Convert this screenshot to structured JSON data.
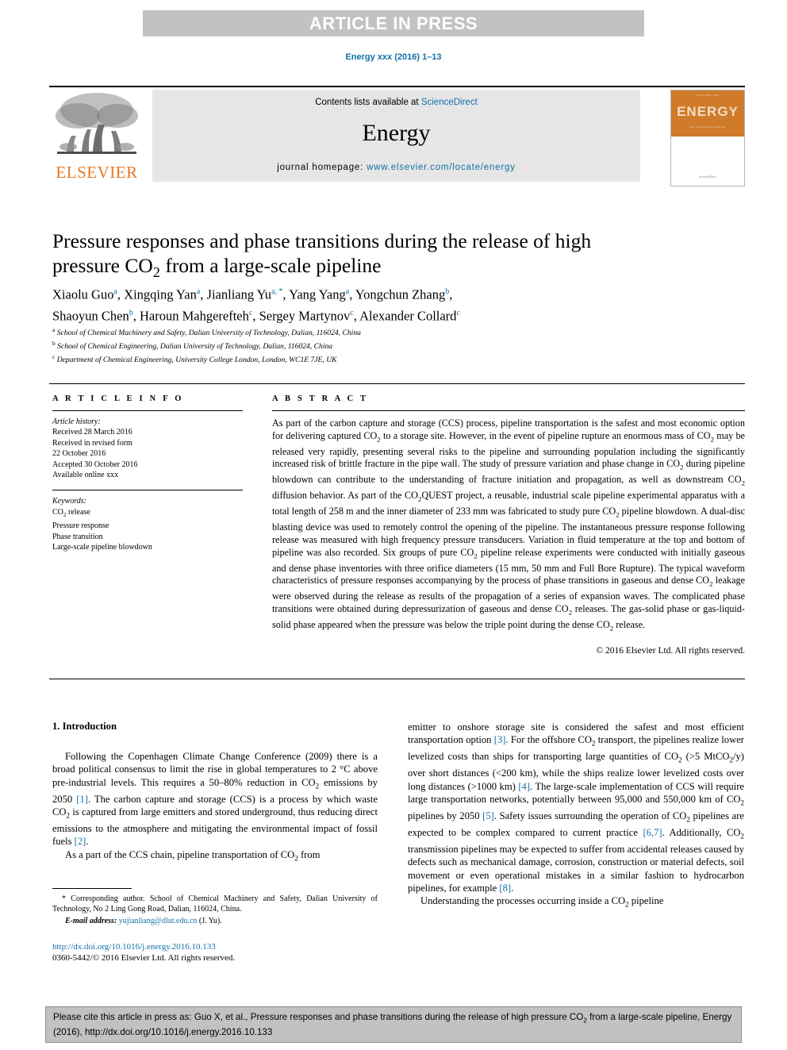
{
  "banner": {
    "label": "ARTICLE IN PRESS"
  },
  "journal_ref": "Energy xxx (2016) 1–13",
  "masthead": {
    "contents_prefix": "Contents lists available at ",
    "sciencedirect": "ScienceDirect",
    "journal_name": "Energy",
    "homepage_prefix": "journal homepage: ",
    "homepage_url": "www.elsevier.com/locate/energy",
    "publisher": "ELSEVIER",
    "cover_title": "ENERGY",
    "cover_subtitle": "The International Journal",
    "cover_footer": "ScienceDirect"
  },
  "article": {
    "title_line1": "Pressure responses and phase transitions during the release of high",
    "title_line2_a": "pressure CO",
    "title_line2_sub": "2",
    "title_line2_b": " from a large-scale pipeline",
    "authors": [
      {
        "name": "Xiaolu Guo",
        "marks": "a"
      },
      {
        "name": "Xingqing Yan",
        "marks": "a"
      },
      {
        "name": "Jianliang Yu",
        "marks": "a, *"
      },
      {
        "name": "Yang Yang",
        "marks": "a"
      },
      {
        "name": "Yongchun Zhang",
        "marks": "b"
      },
      {
        "name": "Shaoyun Chen",
        "marks": "b"
      },
      {
        "name": "Haroun Mahgerefteh",
        "marks": "c"
      },
      {
        "name": "Sergey Martynov",
        "marks": "c"
      },
      {
        "name": "Alexander Collard",
        "marks": "c"
      }
    ],
    "affiliations": [
      {
        "mark": "a",
        "text": "School of Chemical Machinery and Safety, Dalian University of Technology, Dalian, 116024, China"
      },
      {
        "mark": "b",
        "text": "School of Chemical Engineering, Dalian University of Technology, Dalian, 116024, China"
      },
      {
        "mark": "c",
        "text": "Department of Chemical Engineering, University College London, London, WC1E 7JE, UK"
      }
    ]
  },
  "article_info": {
    "heading": "A R T I C L E  I N F O",
    "history_label": "Article history:",
    "history": [
      "Received 28 March 2016",
      "Received in revised form",
      "22 October 2016",
      "Accepted 30 October 2016",
      "Available online xxx"
    ],
    "keywords_label": "Keywords:",
    "keywords": [
      "CO2 release",
      "Pressure response",
      "Phase transition",
      "Large-scale pipeline blowdown"
    ]
  },
  "abstract": {
    "heading": "A B S T R A C T",
    "text": "As part of the carbon capture and storage (CCS) process, pipeline transportation is the safest and most economic option for delivering captured CO2 to a storage site. However, in the event of pipeline rupture an enormous mass of CO2 may be released very rapidly, presenting several risks to the pipeline and surrounding population including the significantly increased risk of brittle fracture in the pipe wall. The study of pressure variation and phase change in CO2 during pipeline blowdown can contribute to the understanding of fracture initiation and propagation, as well as downstream CO2 diffusion behavior. As part of the CO2QUEST project, a reusable, industrial scale pipeline experimental apparatus with a total length of 258 m and the inner diameter of 233 mm was fabricated to study pure CO2 pipeline blowdown. A dual-disc blasting device was used to remotely control the opening of the pipeline. The instantaneous pressure response following release was measured with high frequency pressure transducers. Variation in fluid temperature at the top and bottom of pipeline was also recorded. Six groups of pure CO2 pipeline release experiments were conducted with initially gaseous and dense phase inventories with three orifice diameters (15 mm, 50 mm and Full Bore Rupture). The typical waveform characteristics of pressure responses accompanying by the process of phase transitions in gaseous and dense CO2 leakage were observed during the release as results of the propagation of a series of expansion waves. The complicated phase transitions were obtained during depressurization of gaseous and dense CO2 releases. The gas-solid phase or gas-liquid-solid phase appeared when the pressure was below the triple point during the dense CO2 release.",
    "copyright": "© 2016 Elsevier Ltd. All rights reserved."
  },
  "body": {
    "section_heading": "1. Introduction",
    "left_paragraph_1": "Following the Copenhagen Climate Change Conference (2009) there is a broad political consensus to limit the rise in global temperatures to 2 °C above pre-industrial levels. This requires a 50–80% reduction in CO2 emissions by 2050 [1]. The carbon capture and storage (CCS) is a process by which waste CO2 is captured from large emitters and stored underground, thus reducing direct emissions to the atmosphere and mitigating the environmental impact of fossil fuels [2].",
    "left_paragraph_2": "As a part of the CCS chain, pipeline transportation of CO2 from",
    "right_paragraph_1": "emitter to onshore storage site is considered the safest and most efficient transportation option [3]. For the offshore CO2 transport, the pipelines realize lower levelized costs than ships for transporting large quantities of CO2 (>5 MtCO2/y) over short distances (<200 km), while the ships realize lower levelized costs over long distances (>1000 km) [4]. The large-scale implementation of CCS will require large transportation networks, potentially between 95,000 and 550,000 km of CO2 pipelines by 2050 [5]. Safety issues surrounding the operation of CO2 pipelines are expected to be complex compared to current practice [6,7]. Additionally, CO2 transmission pipelines may be expected to suffer from accidental releases caused by defects such as mechanical damage, corrosion, construction or material defects, soil movement or even operational mistakes in a similar fashion to hydrocarbon pipelines, for example [8].",
    "right_paragraph_2": "Understanding the processes occurring inside a CO2 pipeline"
  },
  "footnote": {
    "corresponding": "* Corresponding author. School of Chemical Machinery and Safety, Dalian University of Technology, No 2 Ling Gong Road, Dalian, 116024, China.",
    "email_label": "E-mail address:",
    "email": "yujianliang@dlut.edu.cn",
    "email_owner": "(J. Yu).",
    "doi": "http://dx.doi.org/10.1016/j.energy.2016.10.133",
    "issn_line": "0360-5442/© 2016 Elsevier Ltd. All rights reserved."
  },
  "citation_footer": {
    "text": "Please cite this article in press as: Guo X, et al., Pressure responses and phase transitions during the release of high pressure CO2 from a large-scale pipeline, Energy (2016), http://dx.doi.org/10.1016/j.energy.2016.10.133"
  },
  "colors": {
    "link_blue": "#1270a8",
    "banner_gray": "#c2c2c2",
    "elsevier_orange": "#e87722",
    "masthead_gray": "#e6e6e6"
  }
}
